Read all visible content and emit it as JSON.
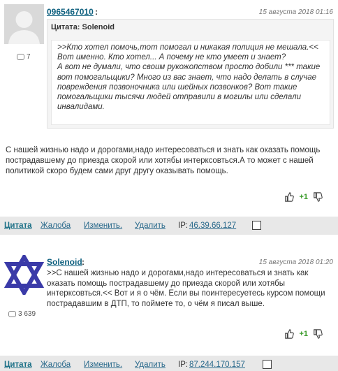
{
  "post1": {
    "author": "0965467010",
    "date": "15 августа 2018 01:16",
    "post_count": "7",
    "quote_title": "Цитата: Solenoid",
    "quote_text": ">>Кто хотел помочь,тот помогал и никакая полиция не мешала.<<\nВот именно. Кто хотел... А почему не кто умеет и знает?\nА вот не думали, что своим рукожопством просто добили *** такие вот помогальщики? Много из вас знает, что надо делать в случае повреждения позвоночника или шейных позвонков? Вот такие помогальщики тысячи людей отправили в могилы или сделали инвалидами.",
    "body": "С нашей жизнью надо и дорогами,надо интересоваться и знать как оказать помощь пострадавшему до приезда скорой или хотябы интеркcовться.А то может с нашей политикой скоро будем сами друг другу оказывать помощь.",
    "score": "+1",
    "toolbar": {
      "quote": "Цитата",
      "complaint": "Жалоба",
      "edit": "Изменить.",
      "delete": "Удалить",
      "ip_label": "IP:",
      "ip": "46.39.66.127"
    }
  },
  "post2": {
    "author": "Solenoid",
    "date": "15 августа 2018 01:20",
    "post_count": "3 639",
    "body": ">>С нашей жизнью надо и дорогами,надо интересоваться и знать как оказать помощь пострадавшему до приезда скорой или хотябы интеркcовться.<< Вот и я о чём. Если вы поинтересуетесь курсом помощи пострадавшим в ДТП, то поймете то, о чём я писал выше.",
    "score": "+1",
    "toolbar": {
      "quote": "Цитата",
      "complaint": "Жалоба",
      "edit": "Изменить.",
      "delete": "Удалить",
      "ip_label": "IP:",
      "ip": "87.244.170.157"
    }
  },
  "colors": {
    "accent_link": "#2a6a8c",
    "score_green": "#3a9b2a",
    "toolbar_bg": "#e8e8e8",
    "star_blue": "#3a3aa8"
  },
  "icons": [
    "default-avatar-icon",
    "comment-bubble-icon",
    "star-of-david-avatar-icon",
    "thumbs-up-icon",
    "thumbs-down-icon"
  ]
}
